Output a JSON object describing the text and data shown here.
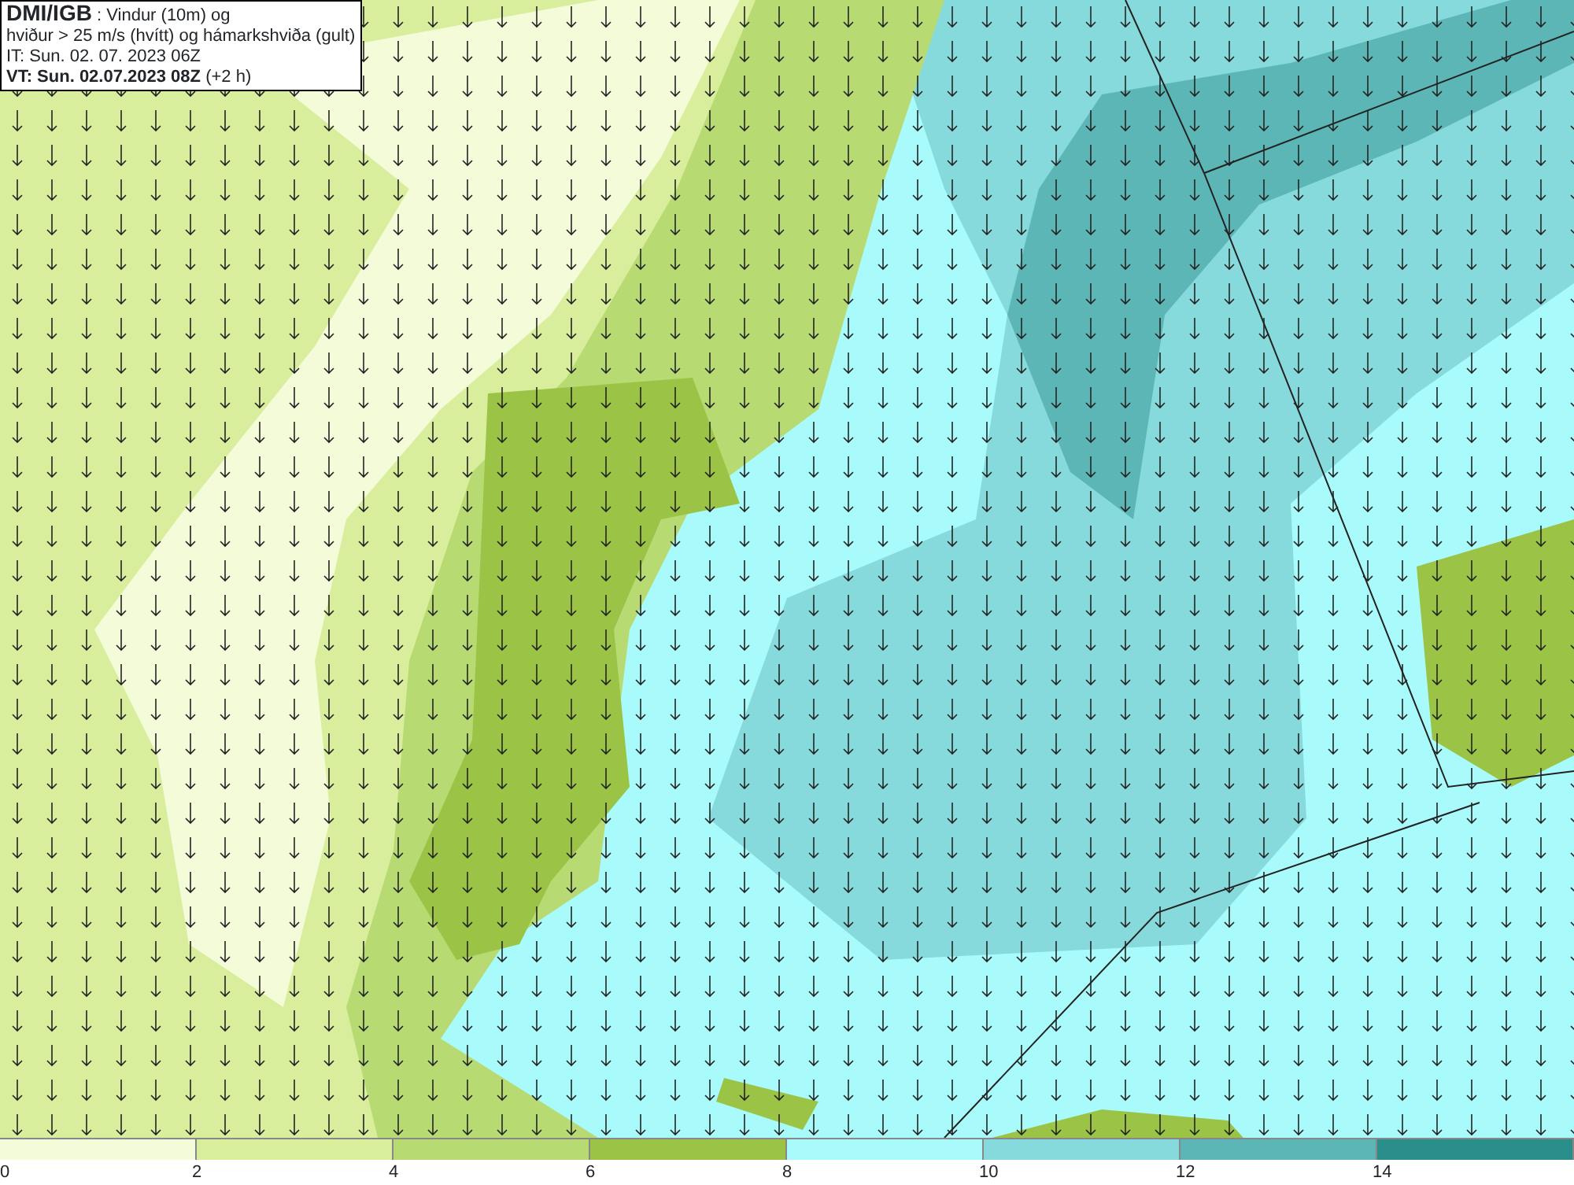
{
  "info_box": {
    "lines": [
      "**DMI/IGB** : Vindur (10m) og",
      "hviður > 25 m/s (hvítt) og hámarkshviða (gult)",
      "IT: Sun. 02. 07. 2023 06Z",
      "**VT: Sun. 02.07.2023 08Z** (+2 h)"
    ]
  },
  "legend": {
    "bins": [
      {
        "label": "0",
        "color": "#f4fbd8"
      },
      {
        "label": "2",
        "color": "#d9ee9c"
      },
      {
        "label": "4",
        "color": "#b7db72"
      },
      {
        "label": "6",
        "color": "#9bc446"
      },
      {
        "label": "8",
        "color": "#a9fbfb"
      },
      {
        "label": "10",
        "color": "#86dadb"
      },
      {
        "label": "12",
        "color": "#5cb6b5"
      },
      {
        "label": "14",
        "color": "#2a8f8b"
      }
    ]
  }
}
